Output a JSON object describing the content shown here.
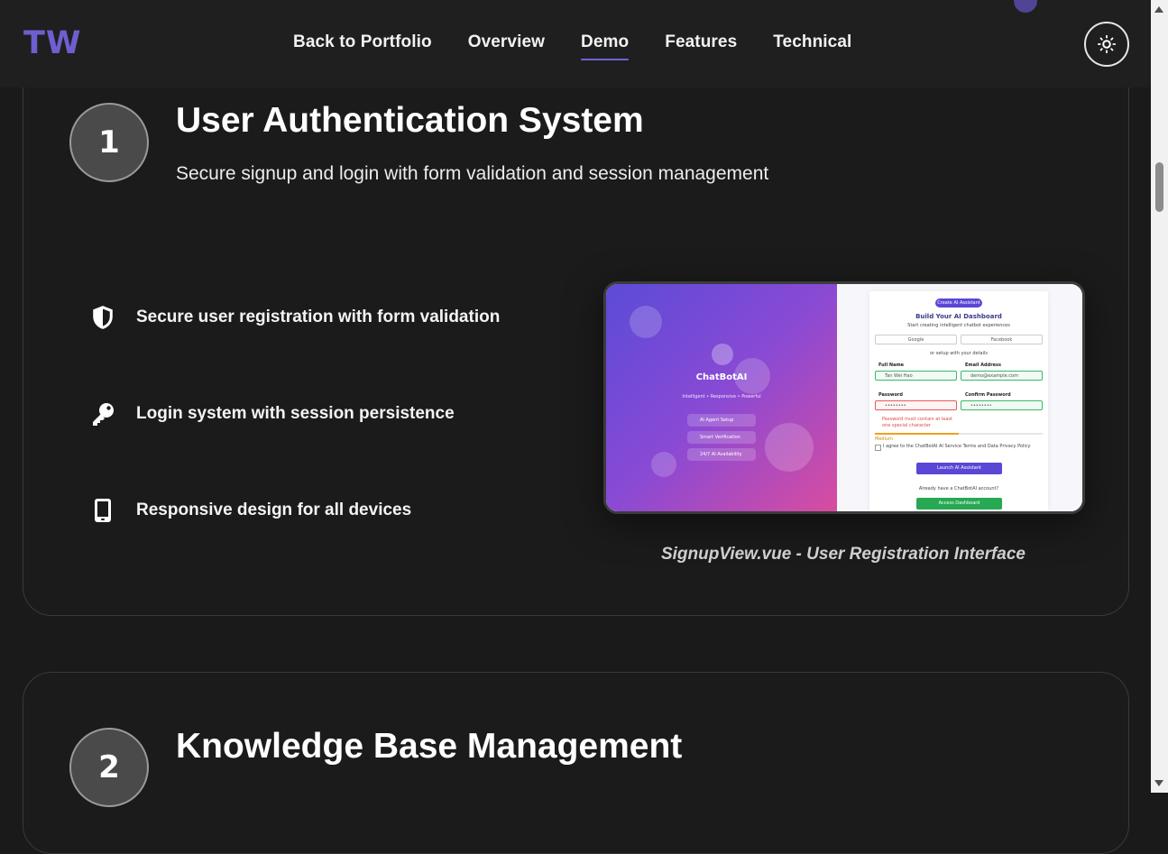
{
  "header": {
    "logo": "TW",
    "nav": [
      "Back to Portfolio",
      "Overview",
      "Demo",
      "Features",
      "Technical"
    ],
    "active_nav": "Demo",
    "theme_toggle_icon": "sun-icon",
    "accent_color": "#6d63d6"
  },
  "steps": [
    {
      "number": "1",
      "title": "User Authentication System",
      "description": "Secure signup and login with form validation and session management",
      "features": [
        {
          "icon": "shield-icon",
          "label": "Secure user registration with form validation"
        },
        {
          "icon": "key-icon",
          "label": "Login system with session persistence"
        },
        {
          "icon": "mobile-icon",
          "label": "Responsive design for all devices"
        }
      ],
      "screenshot": {
        "caption": "SignupView.vue - User Registration Interface",
        "brand": "ChatBotAI",
        "tagline": "Intelligent • Responsive • Powerful",
        "pills": [
          "AI Agent Setup",
          "Smart Verification",
          "24/7 AI Availability"
        ],
        "badge": "Create AI Assistant",
        "heading": "Build Your AI Dashboard",
        "subheading": "Start creating intelligent chatbot experiences",
        "social": [
          "Google",
          "Facebook"
        ],
        "divider": "or setup with your details",
        "fields": {
          "full_name_label": "Full Name",
          "full_name_value": "Tan Wei Hao",
          "email_label": "Email Address",
          "email_value": "demo@example.com",
          "password_label": "Password",
          "password_value": "••••••••",
          "confirm_label": "Confirm Password",
          "confirm_value": "••••••••"
        },
        "error": "Password must contain at least one special character",
        "strength": "Medium",
        "terms": "I agree to the ChatBotAI AI Service Terms and Data Privacy Policy",
        "launch_button": "Launch AI Assistant",
        "signin_prompt": "Already have a ChatBotAI account?",
        "access_button": "Access Dashboard"
      }
    },
    {
      "number": "2",
      "title": "Knowledge Base Management"
    }
  ]
}
